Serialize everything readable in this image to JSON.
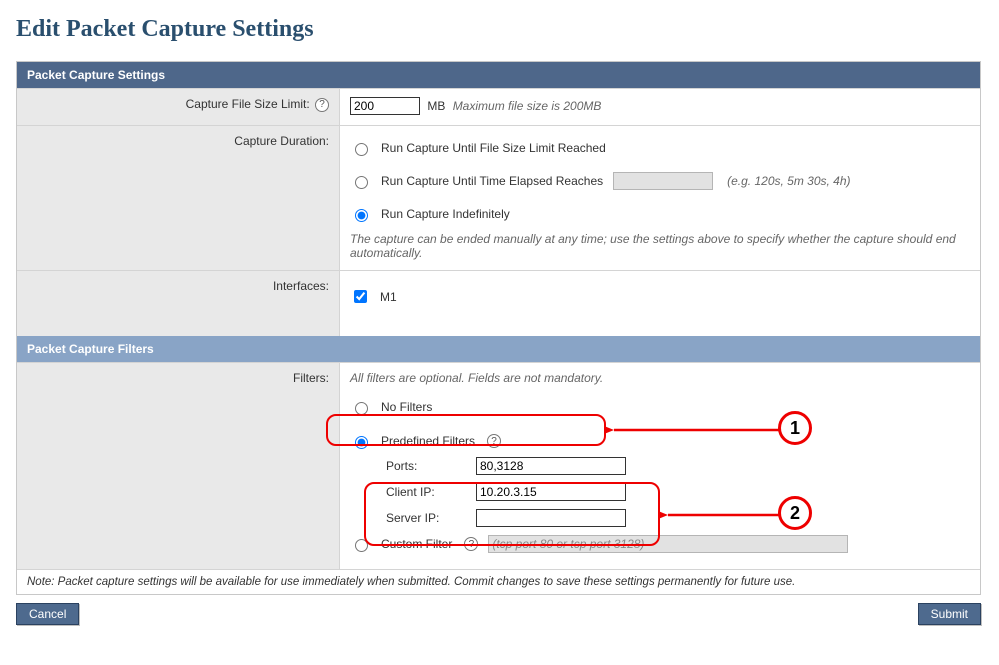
{
  "page": {
    "title": "Edit Packet Capture Settings"
  },
  "sections": {
    "settings_header": "Packet Capture Settings",
    "filters_header": "Packet Capture Filters"
  },
  "capture_size": {
    "label": "Capture File Size Limit:",
    "value": "200",
    "unit": "MB",
    "hint": "Maximum file size is 200MB"
  },
  "capture_duration": {
    "label": "Capture Duration:",
    "options": {
      "until_size": "Run Capture Until File Size Limit Reached",
      "until_time": "Run Capture Until Time Elapsed Reaches",
      "until_time_hint": "(e.g. 120s, 5m 30s, 4h)",
      "indef": "Run Capture Indefinitely"
    },
    "selected": "indef",
    "time_value": "",
    "note": "The capture can be ended manually at any time; use the settings above to specify whether the capture should end automatically."
  },
  "interfaces": {
    "label": "Interfaces:",
    "items": [
      {
        "name": "M1",
        "checked": true
      }
    ]
  },
  "filters": {
    "label": "Filters:",
    "intro": "All filters are optional. Fields are not mandatory.",
    "options": {
      "none": "No Filters",
      "predef": "Predefined Filters",
      "custom": "Custom Filter"
    },
    "selected": "predef",
    "predef": {
      "ports_label": "Ports:",
      "ports_value": "80,3128",
      "client_ip_label": "Client IP:",
      "client_ip_value": "10.20.3.15",
      "server_ip_label": "Server IP:",
      "server_ip_value": ""
    },
    "custom_placeholder": "(tcp port 80 or tcp port 3128)"
  },
  "footer_note": "Note: Packet capture settings will be available for use immediately when submitted. Commit changes to save these settings permanently for future use.",
  "buttons": {
    "cancel": "Cancel",
    "submit": "Submit"
  },
  "annotations": {
    "one": "1",
    "two": "2"
  }
}
